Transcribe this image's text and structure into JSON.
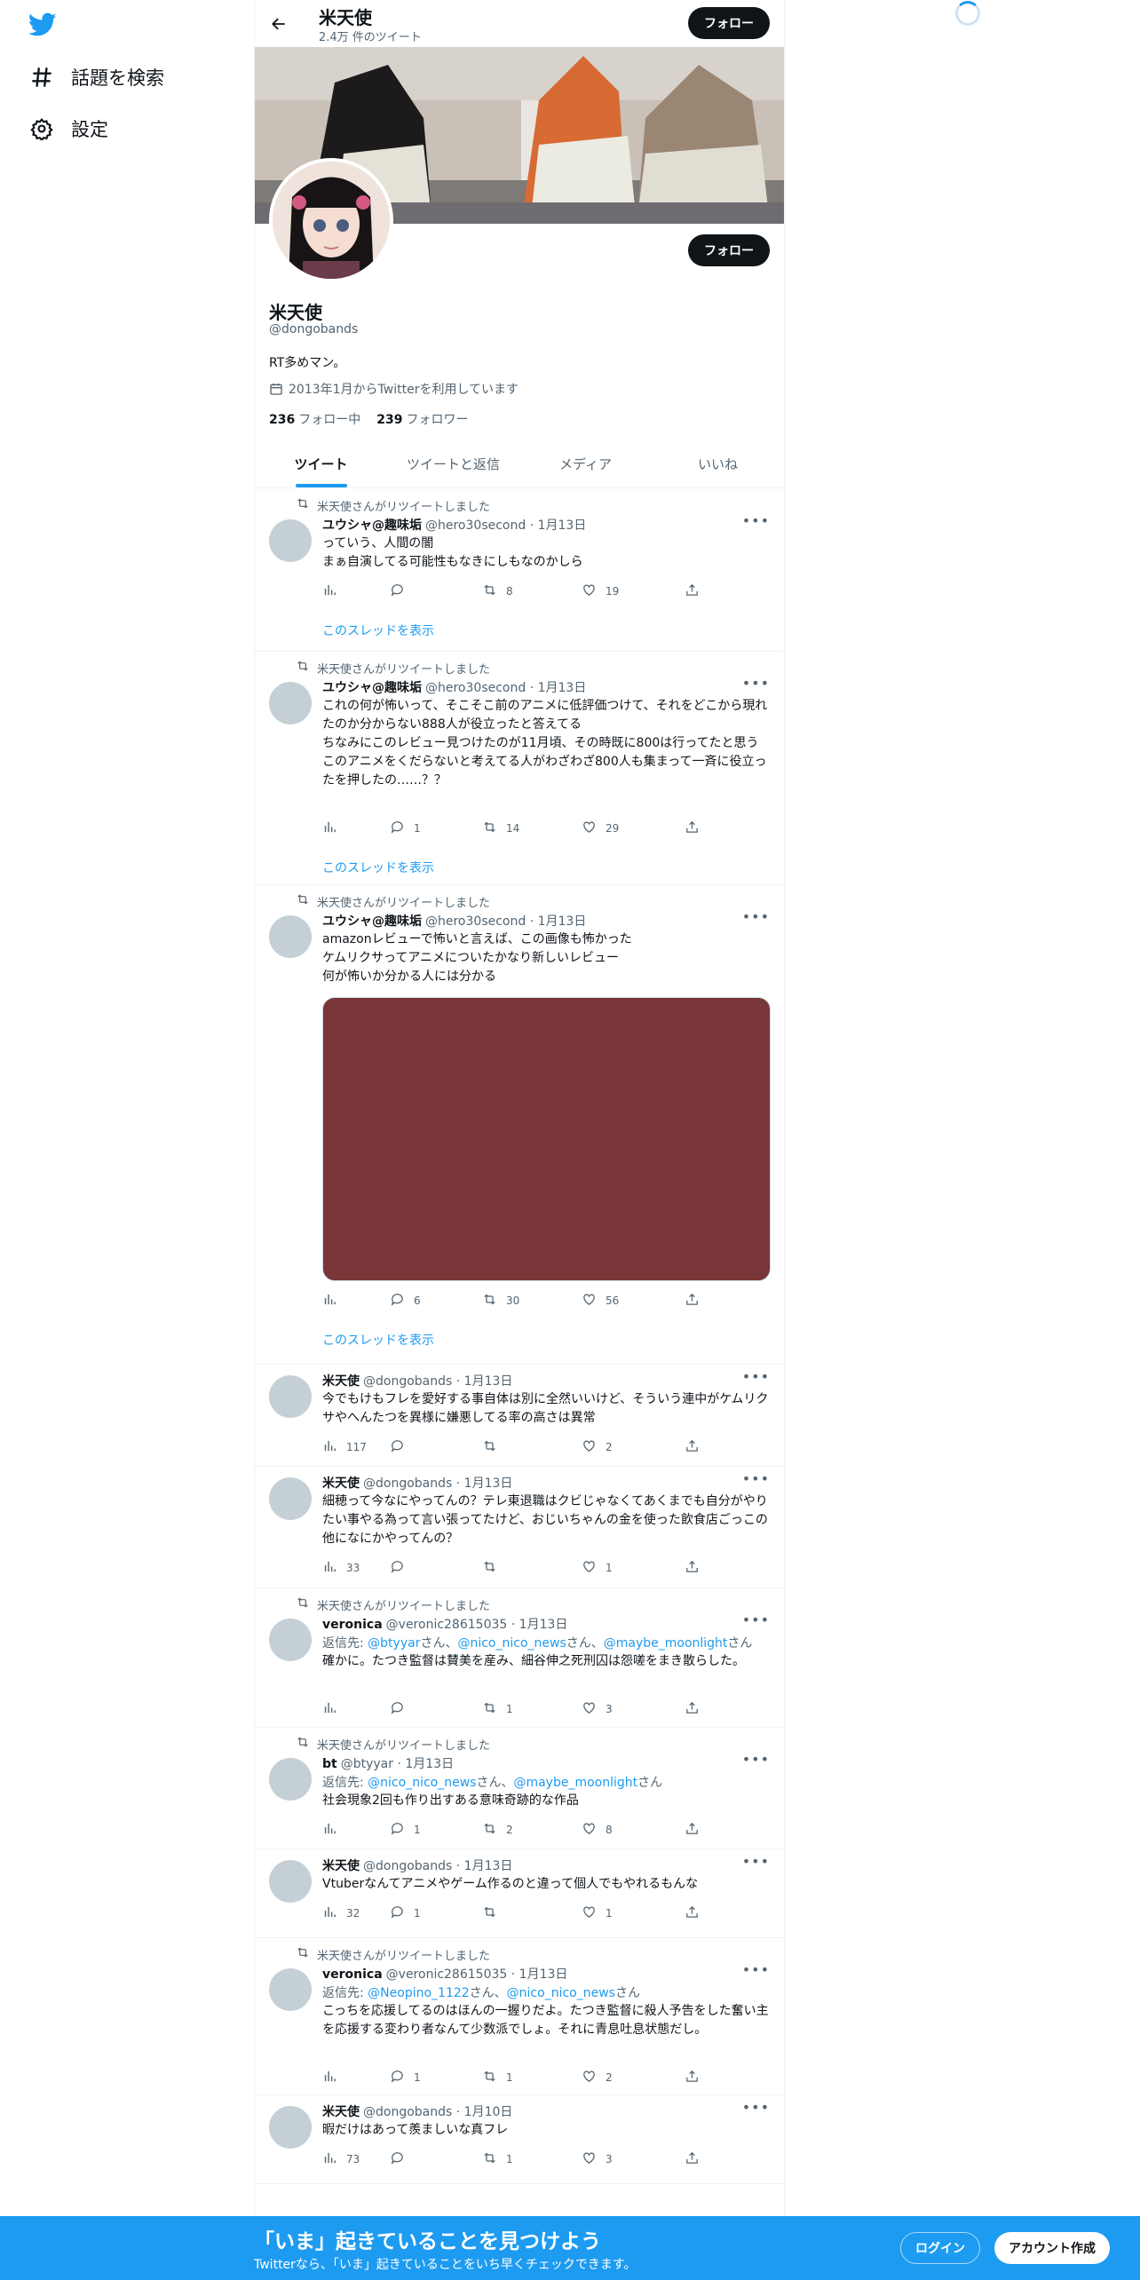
{
  "nav": {
    "explore_label": "話題を検索",
    "settings_label": "設定"
  },
  "header": {
    "name": "米天使",
    "tweet_count": "2.4万 件のツイート",
    "follow_label": "フォロー"
  },
  "profile": {
    "name": "米天使",
    "handle": "@dongobands",
    "bio": "RT多めマン。",
    "joined": "2013年1月からTwitterを利用しています",
    "following_count": "236",
    "following_label": "フォロー中",
    "followers_count": "239",
    "followers_label": "フォロワー",
    "follow_label": "フォロー"
  },
  "tabs": [
    "ツイート",
    "ツイートと返信",
    "メディア",
    "いいね"
  ],
  "retweet_label": "米天使さんがリツイートしました",
  "show_thread": "このスレッドを表示",
  "reply_prefix": "返信先: ",
  "reply_suffix": "さん",
  "tweets": [
    {
      "retweet": true,
      "name": "ユウシャ@趣味垢",
      "handle": "@hero30second",
      "date": "1月13日",
      "text": "っていう、人間の闇\nまぁ自演してる可能性もなきにしもなのかしら",
      "views": "",
      "replies": "",
      "retweets": "8",
      "likes": "19",
      "thread": true
    },
    {
      "retweet": true,
      "name": "ユウシャ@趣味垢",
      "handle": "@hero30second",
      "date": "1月13日",
      "text": "これの何が怖いって、そこそこ前のアニメに低評価つけて、それをどこから現れたのか分からない888人が役立ったと答えてる\nちなみにこのレビュー見つけたのが11月頃、その時既に800は行ってたと思う\nこのアニメをくだらないと考えてる人がわざわざ800人も集まって一斉に役立ったを押したの……？？",
      "views": "",
      "replies": "1",
      "retweets": "14",
      "likes": "29",
      "thread": true
    },
    {
      "retweet": true,
      "name": "ユウシャ@趣味垢",
      "handle": "@hero30second",
      "date": "1月13日",
      "text": "amazonレビューで怖いと言えば、この画像も怖かった\nケムリクサってアニメについたかなり新しいレビュー\n何が怖いか分かる人には分かる",
      "views": "",
      "replies": "6",
      "retweets": "30",
      "likes": "56",
      "thread": true
    },
    {
      "retweet": false,
      "name": "米天使",
      "handle": "@dongobands",
      "date": "1月13日",
      "text": "今でもけもフレを愛好する事自体は別に全然いいけど、そういう連中がケムリクサやへんたつを異様に嫌悪してる率の高さは異常",
      "views": "117",
      "replies": "",
      "retweets": "",
      "likes": "2",
      "thread": false
    },
    {
      "retweet": false,
      "name": "米天使",
      "handle": "@dongobands",
      "date": "1月13日",
      "text": "細穂って今なにやってんの？テレ東退職はクビじゃなくてあくまでも自分がやりたい事やる為って言い張ってたけど、おじいちゃんの金を使った飲食店ごっこの他になにかやってんの？",
      "views": "33",
      "replies": "",
      "retweets": "",
      "likes": "1",
      "thread": false
    },
    {
      "retweet": true,
      "name": "veronica",
      "handle": "@veronic28615035",
      "date": "1月13日",
      "replyTo": [
        "@btyyar",
        "@nico_nico_news",
        "@maybe_moonlight"
      ],
      "text": "確かに。たつき監督は賛美を産み、細谷伸之死刑囚は怨嗟をまき散らした。",
      "views": "",
      "replies": "",
      "retweets": "1",
      "likes": "3",
      "thread": false
    },
    {
      "retweet": true,
      "name": "bt",
      "handle": "@btyyar",
      "date": "1月13日",
      "replyTo": [
        "@nico_nico_news",
        "@maybe_moonlight"
      ],
      "text": "社会現象2回も作り出すある意味奇跡的な作品",
      "views": "",
      "replies": "1",
      "retweets": "2",
      "likes": "8",
      "thread": false
    },
    {
      "retweet": false,
      "name": "米天使",
      "handle": "@dongobands",
      "date": "1月13日",
      "text": "Vtuberなんてアニメやゲーム作るのと違って個人でもやれるもんな",
      "views": "32",
      "replies": "1",
      "retweets": "",
      "likes": "1",
      "thread": false
    },
    {
      "retweet": true,
      "name": "veronica",
      "handle": "@veronic28615035",
      "date": "1月13日",
      "replyTo": [
        "@Neopino_1122",
        "@nico_nico_news"
      ],
      "text": "こっちを応援してるのはほんの一握りだよ。たつき監督に殺人予告をした奮い主を応援する変わり者なんて少数派でしょ。それに青息吐息状態だし。",
      "views": "",
      "replies": "1",
      "retweets": "1",
      "likes": "2",
      "thread": false
    },
    {
      "retweet": false,
      "name": "米天使",
      "handle": "@dongobands",
      "date": "1月10日",
      "text": "暇だけはあって羨ましいな真フレ",
      "views": "73",
      "replies": "",
      "retweets": "1",
      "likes": "3",
      "thread": false
    }
  ],
  "bottom_bar": {
    "title": "「いま」起きていることを見つけよう",
    "subtitle": "Twitterなら、「いま」起きていることをいち早くチェックできます。",
    "login_label": "ログイン",
    "signup_label": "アカウント作成"
  },
  "colors": {
    "accent": "#1d9bf0",
    "media_placeholder": "#783638"
  }
}
